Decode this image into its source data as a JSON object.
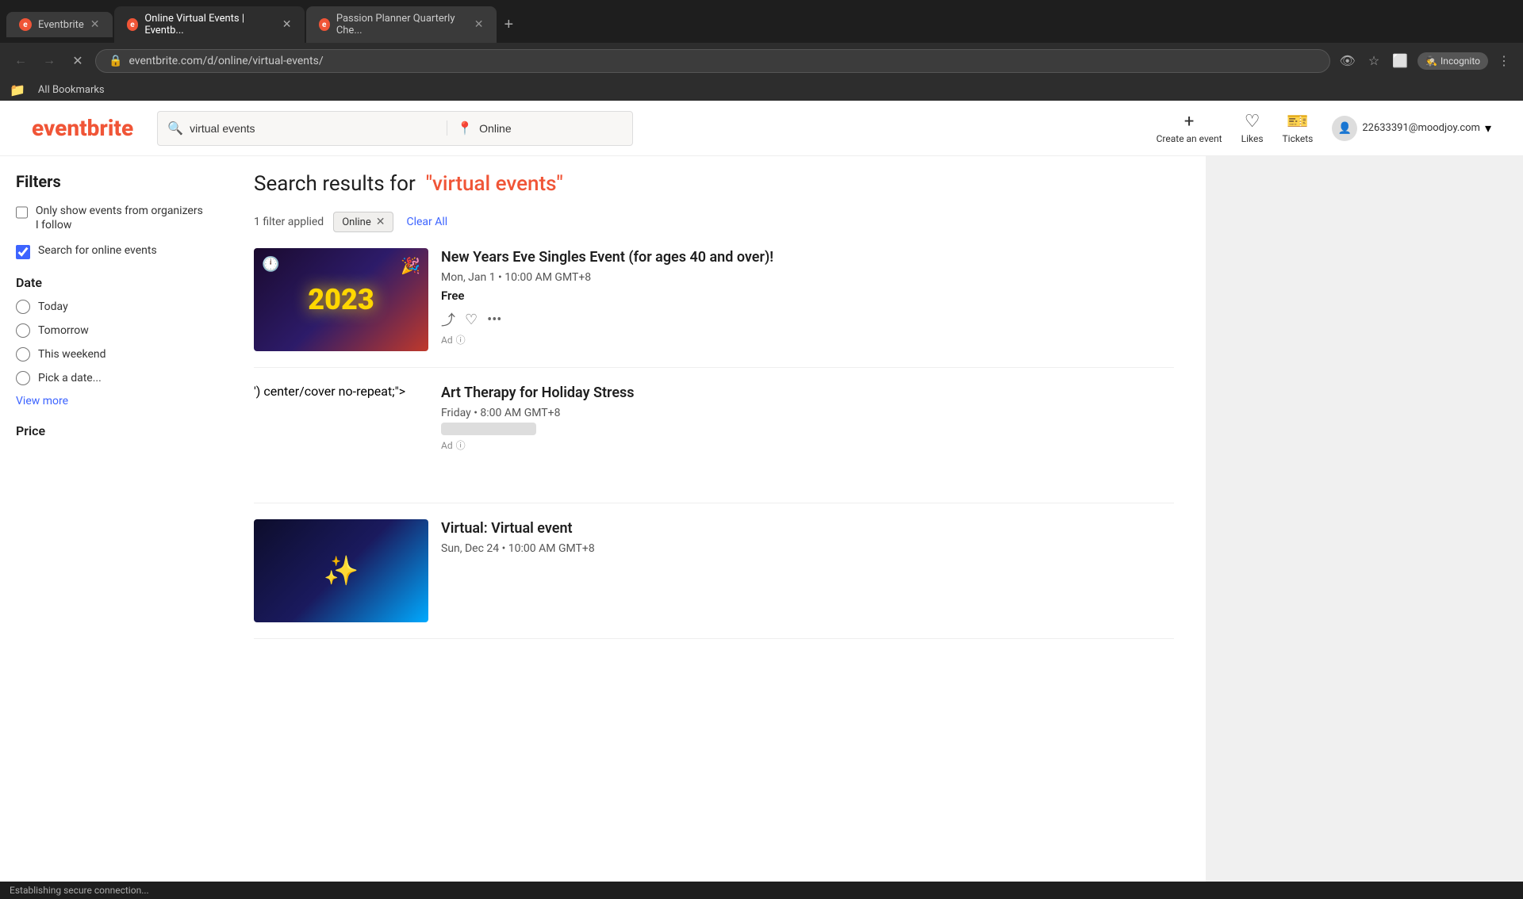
{
  "browser": {
    "tabs": [
      {
        "id": "tab1",
        "favicon": "eb",
        "label": "Eventbrite",
        "active": false
      },
      {
        "id": "tab2",
        "favicon": "online",
        "label": "Online Virtual Events | Eventb...",
        "active": true
      },
      {
        "id": "tab3",
        "favicon": "passion",
        "label": "Passion Planner Quarterly Che...",
        "active": false
      }
    ],
    "url": "eventbrite.com/d/online/virtual-events/",
    "incognito_label": "Incognito"
  },
  "header": {
    "logo": "eventbrite",
    "search_value": "virtual events",
    "location_value": "Online",
    "location_placeholder": "Online",
    "create_label": "Create an event",
    "likes_label": "Likes",
    "tickets_label": "Tickets",
    "user_email": "22633391@moodjoy.com"
  },
  "search": {
    "title_prefix": "Search results for",
    "query": "\"virtual events\""
  },
  "filters_bar": {
    "count_label": "1 filter applied",
    "active_filter": "Online",
    "clear_all_label": "Clear All"
  },
  "sidebar": {
    "filters_title": "Filters",
    "organizer_checkbox_label": "Only show events from organizers I follow",
    "organizer_checked": false,
    "online_checkbox_label": "Search for online events",
    "online_checked": true,
    "date_section_title": "Date",
    "date_options": [
      {
        "label": "Today",
        "value": "today"
      },
      {
        "label": "Tomorrow",
        "value": "tomorrow"
      },
      {
        "label": "This weekend",
        "value": "this-weekend"
      },
      {
        "label": "Pick a date...",
        "value": "pick-date"
      }
    ],
    "view_more_label": "View more",
    "price_section_title": "Price"
  },
  "events": [
    {
      "id": "event1",
      "title": "New Years Eve Singles Event (for ages 40 and over)!",
      "date": "Mon, Jan 1 • 10:00 AM GMT+8",
      "price": "Free",
      "is_ad": true,
      "ad_label": "Ad",
      "image_type": "nye"
    },
    {
      "id": "event2",
      "title": "Art Therapy for Holiday Stress",
      "date": "Friday • 8:00 AM GMT+8",
      "price_hidden": true,
      "is_ad": true,
      "ad_label": "Ad",
      "image_type": "art"
    },
    {
      "id": "event3",
      "title": "Virtual: Virtual event",
      "date": "Sun, Dec 24 • 10:00 AM GMT+8",
      "price": "",
      "is_ad": false,
      "image_type": "virtual"
    }
  ],
  "status_bar": {
    "message": "Establishing secure connection..."
  }
}
